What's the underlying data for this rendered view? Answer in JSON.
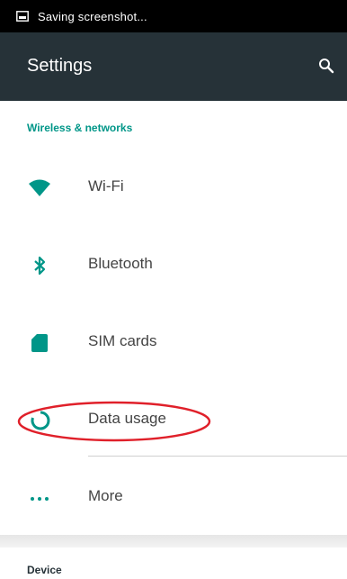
{
  "status_bar": {
    "text": "Saving screenshot..."
  },
  "app_bar": {
    "title": "Settings",
    "search_icon": "search-icon"
  },
  "sections": {
    "wireless": {
      "header": "Wireless & networks"
    },
    "device": {
      "header": "Device"
    }
  },
  "items": [
    {
      "label": "Wi-Fi",
      "icon": "wifi-icon"
    },
    {
      "label": "Bluetooth",
      "icon": "bluetooth-icon"
    },
    {
      "label": "SIM cards",
      "icon": "sim-card-icon"
    },
    {
      "label": "Data usage",
      "icon": "data-usage-icon"
    },
    {
      "label": "More",
      "icon": "more-icon"
    }
  ],
  "colors": {
    "app_bar": "#263238",
    "accent": "#009688",
    "annotation": "#e0202a"
  }
}
